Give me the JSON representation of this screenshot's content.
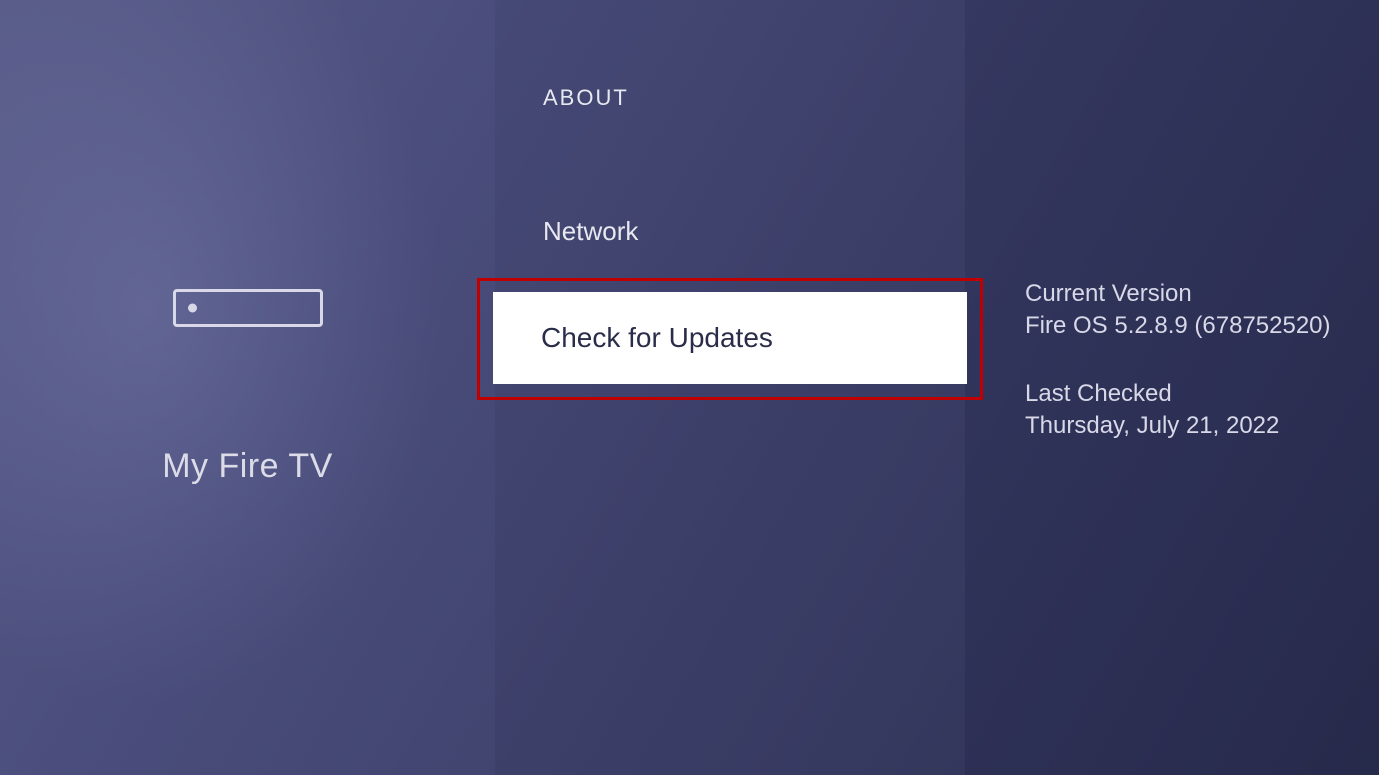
{
  "left": {
    "title": "My Fire TV"
  },
  "middle": {
    "header": "ABOUT",
    "items": [
      {
        "label": "Network",
        "selected": false
      },
      {
        "label": "Check for Updates",
        "selected": true
      }
    ]
  },
  "right": {
    "version_label": "Current Version",
    "version_value": "Fire OS 5.2.8.9 (678752520)",
    "checked_label": "Last Checked",
    "checked_value": "Thursday, July 21, 2022"
  }
}
